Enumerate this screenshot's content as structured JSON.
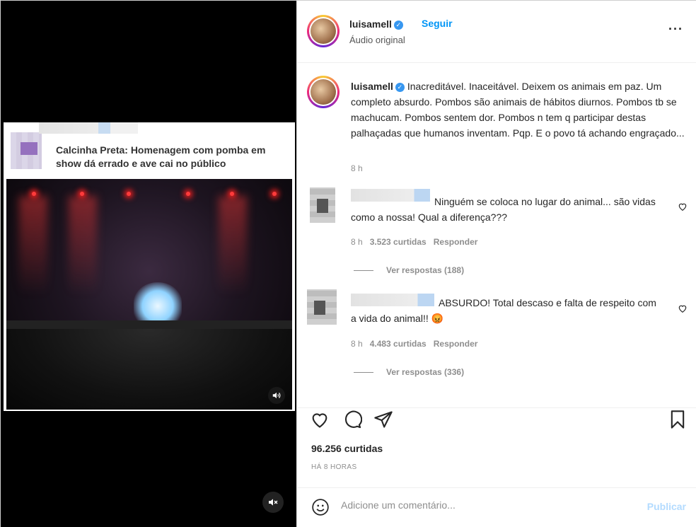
{
  "media": {
    "card_title": "Calcinha Preta: Homenagem com pomba em show dá errado e ave cai no público",
    "mute_icon": "speaker-muted-icon"
  },
  "header": {
    "username": "luisamell",
    "follow_label": "Seguir",
    "audio_label": "Áudio original",
    "more_icon": "more-horizontal-icon"
  },
  "caption": {
    "username": "luisamell",
    "text": "Inacreditável. Inaceitável. Deixem os animais em paz. Um completo absurdo. Pombos são animais de hábitos diurnos. Pombos tb se machucam. Pombos sentem dor. Pombos n tem q participar destas palhaçadas que humanos inventam. Pqp. E o povo tá achando engraçado...",
    "time": "8 h"
  },
  "comments": [
    {
      "text": "Ninguém se coloca no lugar do animal... são vidas como a nossa! Qual a diferença???",
      "time": "8 h",
      "likes": "3.523 curtidas",
      "reply_label": "Responder",
      "view_replies": "Ver respostas (188)"
    },
    {
      "text": "ABSURDO! Total descaso e falta de respeito com a vida do animal!! 😡",
      "time": "8 h",
      "likes": "4.483 curtidas",
      "reply_label": "Responder",
      "view_replies": "Ver respostas (336)"
    }
  ],
  "actions": {
    "like_icon": "heart-icon",
    "comment_icon": "comment-bubble-icon",
    "share_icon": "paper-plane-icon",
    "save_icon": "bookmark-icon"
  },
  "likes_count": "96.256 curtidas",
  "posted_ago": "HÁ 8 HORAS",
  "add_comment": {
    "placeholder": "Adicione um comentário...",
    "publish_label": "Publicar",
    "emoji_icon": "smiley-icon"
  },
  "colors": {
    "link_blue": "#0095f6",
    "verified_blue": "#3797f0",
    "publish_disabled": "#b3dbff"
  }
}
